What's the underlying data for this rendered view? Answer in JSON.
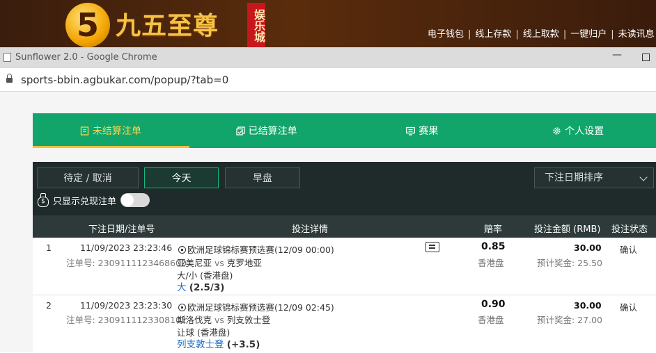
{
  "site": {
    "logo_glyph": "5",
    "logo_text": "九五至尊",
    "logo_seal": "娱乐城",
    "nav": [
      "电子钱包",
      "线上存款",
      "线上取款",
      "一键归户",
      "未读讯息"
    ],
    "nav_separator": "|"
  },
  "window": {
    "title": "Sunflower 2.0 - Google Chrome",
    "minimize": "—",
    "url": "sports-bbin.agbukar.com/popup/?tab=0"
  },
  "tabs": [
    {
      "label": "未结算注单",
      "icon": "receipt-icon",
      "active": true
    },
    {
      "label": "已结算注单",
      "icon": "settled-icon",
      "active": false
    },
    {
      "label": "赛果",
      "icon": "scoreboard-icon",
      "active": false
    },
    {
      "label": "个人设置",
      "icon": "gear-icon",
      "active": false
    }
  ],
  "filters": {
    "pending_cancel": "待定 / 取消",
    "today": "今天",
    "early": "早盘",
    "sort_select": "下注日期排序",
    "cashout_label": "只显示兑现注单",
    "cashout_enabled": false,
    "money_icon_glyph": "$"
  },
  "table": {
    "headers": {
      "date_ticket": "下注日期/注单号",
      "details": "投注详情",
      "odds": "赔率",
      "amount": "投注金额 (RMB)",
      "status": "投注状态"
    },
    "rows": [
      {
        "index": "1",
        "datetime": "11/09/2023 23:23:46",
        "ticket": "注单号: 2309111123468600",
        "league": "欧洲足球锦标赛预选赛(12/09 00:00)",
        "home": "亚美尼亚",
        "vs": "vs",
        "away": "克罗地亚",
        "market": "大/小 (香港盘)",
        "selection": "大",
        "line": "(2.5/3)",
        "odds": "0.85",
        "odds_type": "香港盘",
        "stake": "30.00",
        "payout": "预计奖金: 25.50",
        "status": "确认"
      },
      {
        "index": "2",
        "datetime": "11/09/2023 23:23:30",
        "ticket": "注单号: 2309111123308102",
        "league": "欧洲足球锦标赛预选赛(12/09 02:45)",
        "home": "斯洛伐克",
        "vs": "vs",
        "away": "列支敦士登",
        "market": "让球 (香港盘)",
        "selection": "列支敦士登",
        "line": "(+3.5)",
        "odds": "0.90",
        "odds_type": "香港盘",
        "stake": "30.00",
        "payout": "预计奖金: 27.00",
        "status": "确认"
      }
    ]
  },
  "colors": {
    "tab_green": "#12a56b",
    "active_tab_yellow": "#ffd54a",
    "dark_panel": "#1f2a2a",
    "link_blue": "#1769c9"
  }
}
